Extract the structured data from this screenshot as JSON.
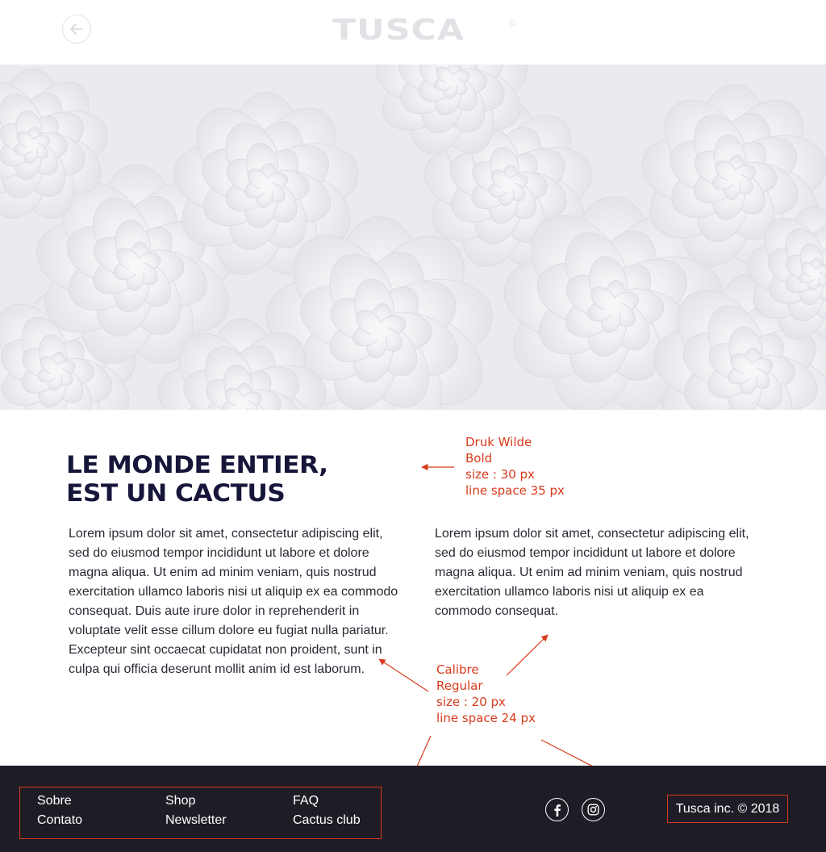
{
  "header": {
    "logo_text": "TUSCA",
    "logo_mark": "©",
    "back_icon": "arrow-left-icon"
  },
  "hero": {
    "image": "succulent-plants-photo"
  },
  "content": {
    "headline_line1": "LE MONDE ENTIER,",
    "headline_line2": "EST UN CACTUS",
    "paragraph_left": "Lorem ipsum dolor sit amet, consectetur adipiscing elit, sed do eiusmod tempor incididunt ut labore et dolore magna aliqua. Ut enim ad minim veniam, quis nostrud exercitation ullamco laboris nisi ut aliquip ex ea commodo consequat. Duis aute irure dolor in reprehenderit in voluptate velit esse cillum dolore eu fugiat nulla pariatur. Excepteur sint occaecat cupidatat non proident, sunt in culpa qui officia deserunt mollit anim id est laborum.",
    "paragraph_right": "Lorem ipsum dolor sit amet, consectetur adipiscing elit, sed do eiusmod tempor incididunt ut labore et dolore magna aliqua. Ut enim ad minim veniam, quis nostrud exercitation ullamco laboris nisi ut aliquip ex ea commodo consequat."
  },
  "annotations": {
    "headline_spec": [
      "Druk Wilde",
      "Bold",
      "size : 30 px",
      "line space 35 px"
    ],
    "body_spec": [
      "Calibre",
      "Regular",
      "size : 20 px",
      "line space 24 px"
    ]
  },
  "footer": {
    "nav": [
      "Sobre",
      "Contato",
      "Shop",
      "Newsletter",
      "FAQ",
      "Cactus club"
    ],
    "social": [
      "facebook-icon",
      "instagram-icon"
    ],
    "copyright": "Tusca inc. © 2018"
  },
  "colors": {
    "annotation": "#d83a1c",
    "headline": "#16153a",
    "footer_bg": "#1f1c25",
    "hero_bg": "#efeff2"
  }
}
